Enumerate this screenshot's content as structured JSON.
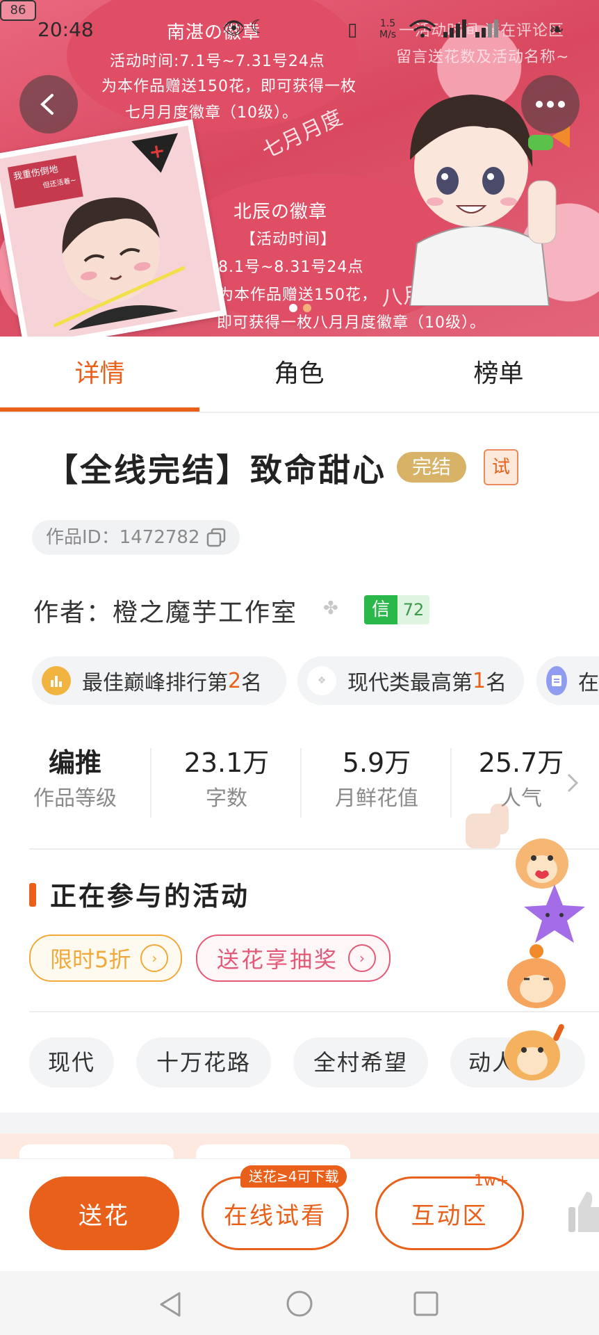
{
  "status_bar": {
    "time": "20:48",
    "net_speed_value": "1.5",
    "net_speed_unit": "M/s",
    "battery": "86"
  },
  "banner": {
    "corner_text_1": "一活动时间 请在评论区",
    "corner_text_2": "留言送花数及活动名称~",
    "july": {
      "badge_title": "南湛の徽章",
      "time": "活动时间:7.1号~7.31号24点",
      "desc_1": "为本作品赠送150花，即可获得一枚",
      "desc_2": "七月月度徽章（10级）。",
      "tag": "七月月度"
    },
    "august": {
      "badge_title": "北辰の徽章",
      "time_label": "【活动时间】",
      "time": "8.1号~8.31号24点",
      "desc_1": "为本作品赠送150花，",
      "desc_2": "即可获得一枚八月月度徽章（10级）。",
      "tag": "八月月度"
    },
    "card_text_1": "我重伤倒地",
    "card_text_2": "但还活着~"
  },
  "tabs": [
    "详情",
    "角色",
    "榜单"
  ],
  "work": {
    "title": "【全线完结】致命甜心",
    "badge_status": "完结",
    "badge_trial": "试",
    "id_text": "作品ID：1472782",
    "author_text": "作者：橙之魔芋工作室",
    "trust_label": "信",
    "trust_value": "72"
  },
  "rank_pills": [
    {
      "text_a": "最佳巅峰排行第",
      "num": "2",
      "text_b": "名"
    },
    {
      "text_a": "现代类最高第",
      "num": "1",
      "text_b": "名"
    },
    {
      "text_a": "在",
      "num": "",
      "text_b": ""
    }
  ],
  "stats": [
    {
      "value": "编推",
      "label": "作品等级"
    },
    {
      "value": "23.1万",
      "label": "字数"
    },
    {
      "value": "5.9万",
      "label": "月鲜花值"
    },
    {
      "value": "25.7万",
      "label": "人气"
    }
  ],
  "activities": {
    "title": "正在参与的活动",
    "items": [
      "限时5折",
      "送花享抽奖"
    ]
  },
  "tags": [
    "现代",
    "十万花路",
    "全村希望",
    "动人"
  ],
  "bottom_bar": {
    "send_flower": "送花",
    "read_online": "在线试看",
    "read_hint": "送花≥4可下载",
    "interact": "互动区",
    "interact_count": "1w+"
  },
  "colors": {
    "accent": "#e8601a",
    "gold": "#d8b266",
    "pink": "#e25a78"
  }
}
